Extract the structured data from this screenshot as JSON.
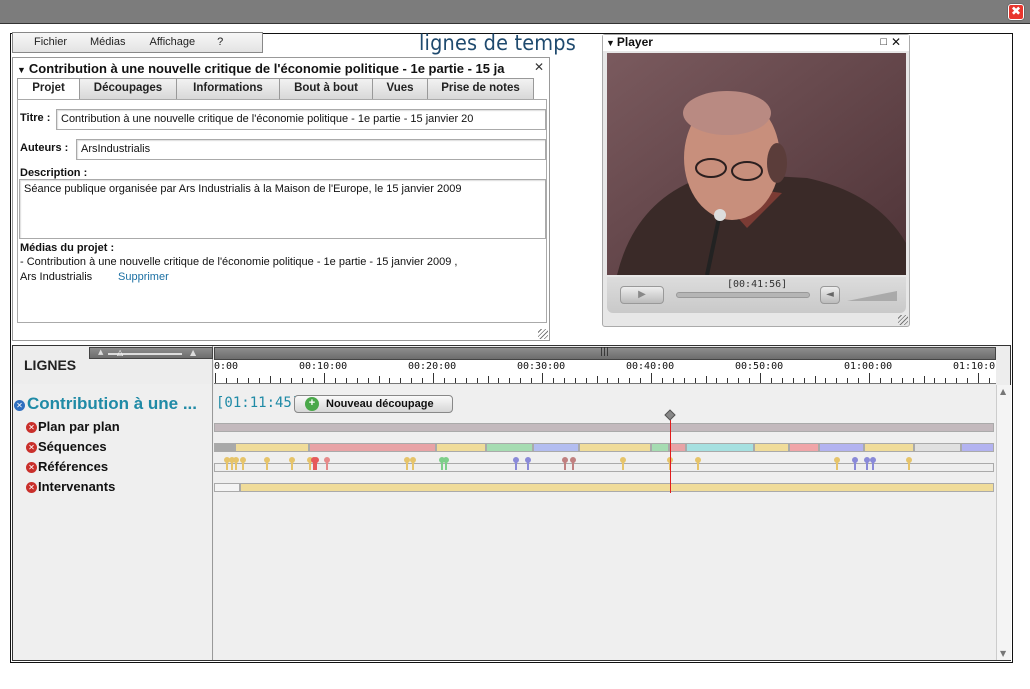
{
  "app": {
    "title": "lignes de temps",
    "close_symbol": "✖"
  },
  "menu": {
    "items": [
      "Fichier",
      "Médias",
      "Affichage",
      "?"
    ]
  },
  "project": {
    "title": "Contribution à une nouvelle critique de l'économie politique - 1e partie - 15 ja",
    "close_symbol": "✕",
    "tabs": [
      "Projet",
      "Découpages",
      "Informations",
      "Bout à bout",
      "Vues",
      "Prise de notes"
    ],
    "active_tab": "Projet",
    "titre_label": "Titre :",
    "titre_value": "Contribution à une nouvelle critique de l'économie politique - 1e partie - 15 janvier 20",
    "auteurs_label": "Auteurs :",
    "auteurs_value": "ArsIndustrialis",
    "description_label": "Description :",
    "description_value": "Séance publique organisée par Ars Industrialis à la Maison de l'Europe, le 15 janvier 2009",
    "medias_label": "Médias du projet :",
    "media_line1": "- Contribution à une nouvelle critique de l'économie politique - 1e partie - 15 janvier 2009 ,",
    "media_line2": "Ars Industrialis",
    "delete_link": "Supprimer"
  },
  "player": {
    "title": "Player",
    "timecode": "[00:41:56]",
    "colors": {
      "video_bg": "#6a4b4d"
    }
  },
  "timeline": {
    "header_label": "LIGNES",
    "project_name": "Contribution à une ...",
    "duration": "[01:11:45]",
    "new_cut_button": "Nouveau découpage",
    "tracks": [
      "Plan par plan",
      "Séquences",
      "Références",
      "Intervenants"
    ],
    "ruler_labels": [
      "0:00",
      "00:10:00",
      "00:20:00",
      "00:30:00",
      "00:40:00",
      "00:50:00",
      "01:00:00",
      "01:10:0"
    ],
    "playhead_fraction": 0.584,
    "colors": {
      "playhead": "#e31b1b",
      "plan_bar": "#c3b9bd",
      "intervenants_bar": "#f0dc9a",
      "project_name": "#1f8aa6"
    }
  }
}
